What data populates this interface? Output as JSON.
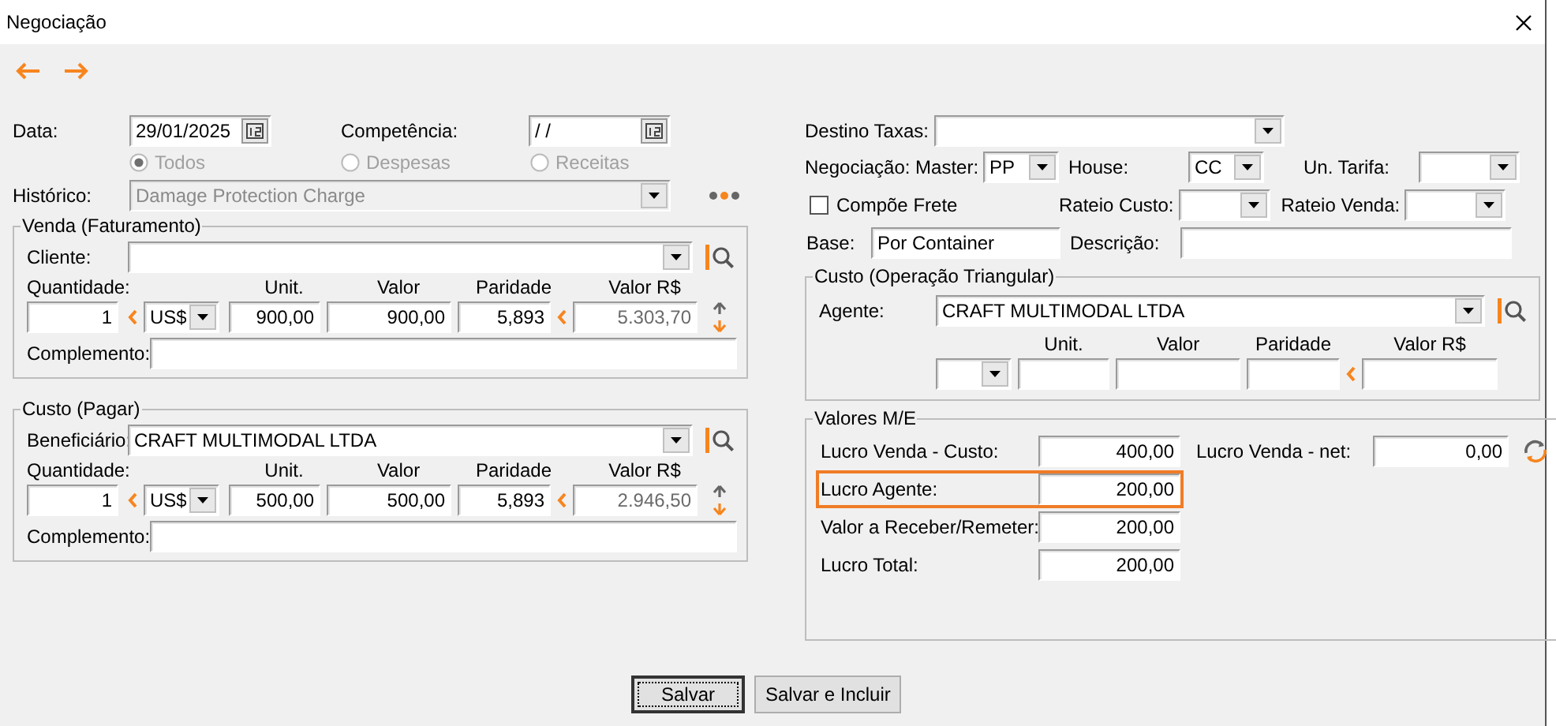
{
  "window": {
    "title": "Negociação"
  },
  "header": {
    "data": {
      "label": "Data:",
      "value": "29/01/2025"
    },
    "competencia": {
      "label": "Competência:",
      "value": "/ /"
    },
    "filter_options": [
      {
        "label": "Todos",
        "selected": true,
        "disabled": true
      },
      {
        "label": "Despesas",
        "selected": false,
        "disabled": true
      },
      {
        "label": "Receitas",
        "selected": false,
        "disabled": true
      }
    ],
    "historico": {
      "label": "Histórico:",
      "value": "Damage Protection Charge",
      "disabled": true
    }
  },
  "venda": {
    "title": "Venda (Faturamento)",
    "party": {
      "label": "Cliente:"
    },
    "columns": [
      "Quantidade:",
      "Unit.",
      "Valor",
      "Paridade",
      "Valor R$"
    ],
    "quantidade": "1",
    "moeda": "US$",
    "unit": "900,00",
    "valor": "900,00",
    "paridade": "5,893",
    "valor_rs": {
      "value": "5.303,70",
      "disabled": true
    },
    "complemento": {
      "label": "Complemento:"
    }
  },
  "custo": {
    "title": "Custo (Pagar)",
    "party": {
      "label": "Beneficiário:",
      "value": "CRAFT MULTIMODAL LTDA"
    },
    "columns": [
      "Quantidade:",
      "Unit.",
      "Valor",
      "Paridade",
      "Valor R$"
    ],
    "quantidade": "1",
    "moeda": "US$",
    "unit": "500,00",
    "valor": "500,00",
    "paridade": "5,893",
    "valor_rs": {
      "value": "2.946,50",
      "disabled": true
    },
    "complemento": {
      "label": "Complemento:"
    }
  },
  "taxas": {
    "destino": {
      "label": "Destino Taxas:"
    },
    "master": {
      "label": "Negociação: Master:",
      "value": "PP"
    },
    "house": {
      "label": "House:",
      "value": "CC"
    },
    "un_tarifa": {
      "label": "Un. Tarifa:"
    },
    "compoe_frete": {
      "label": "Compõe Frete",
      "checked": false
    },
    "rateio_custo": {
      "label": "Rateio Custo:"
    },
    "rateio_venda": {
      "label": "Rateio Venda:"
    },
    "base": {
      "label": "Base:",
      "value": "Por Container"
    },
    "descricao": {
      "label": "Descrição:"
    }
  },
  "triangular": {
    "title": "Custo (Operação Triangular)",
    "agente": {
      "label": "Agente:",
      "value": "CRAFT MULTIMODAL LTDA"
    },
    "columns": [
      "Unit.",
      "Valor",
      "Paridade",
      "Valor R$"
    ]
  },
  "valores": {
    "title": "Valores M/E",
    "rows": [
      {
        "label": "Lucro Venda - Custo:",
        "value": "400,00",
        "highlighted": false
      },
      {
        "label": "Lucro Agente:",
        "value": "200,00",
        "highlighted": true
      },
      {
        "label": "Valor a Receber/Remeter:",
        "value": "200,00",
        "highlighted": false
      },
      {
        "label": "Lucro Total:",
        "value": "200,00",
        "highlighted": false
      }
    ],
    "net": {
      "label": "Lucro Venda - net:",
      "value": "0,00"
    }
  },
  "buttons": [
    {
      "label": "Salvar",
      "default": true
    },
    {
      "label": "Salvar e Incluir",
      "default": false
    }
  ]
}
